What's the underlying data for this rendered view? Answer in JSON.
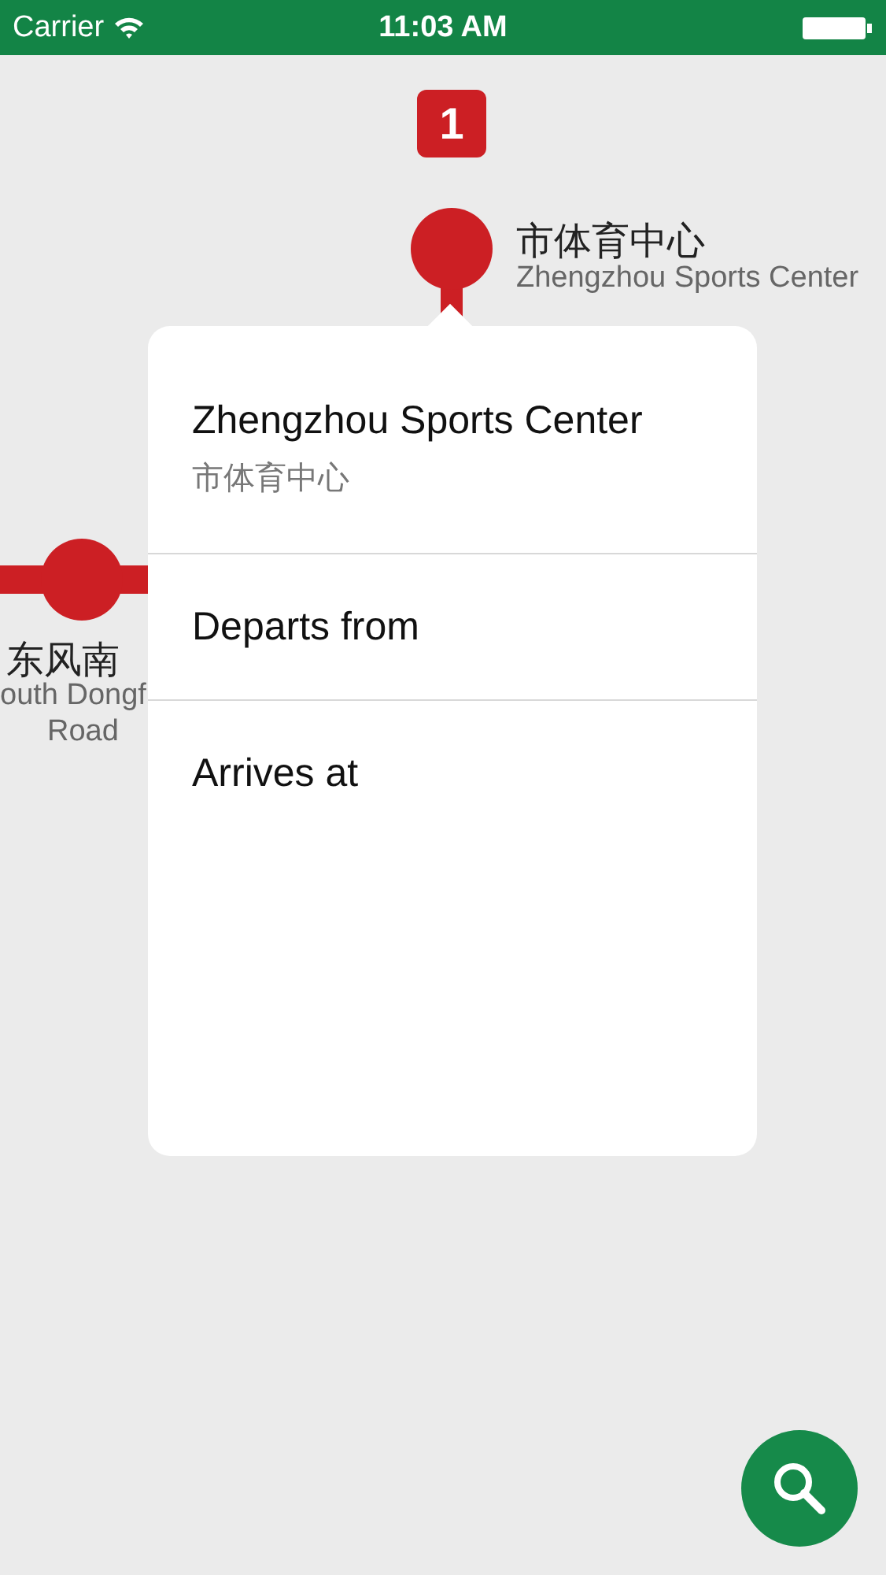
{
  "status_bar": {
    "carrier": "Carrier",
    "time": "11:03 AM"
  },
  "map": {
    "line_badge": "1",
    "stations": [
      {
        "kind": "top",
        "name_zh": "市体育中心",
        "name_en": "Zhengzhou Sports Center"
      },
      {
        "kind": "left",
        "name_zh": "东风南",
        "name_en": "outh Dongf",
        "name_en_2": "Road"
      }
    ]
  },
  "popover": {
    "title": "Zhengzhou Sports Center",
    "subtitle": "市体育中心",
    "rows": [
      {
        "label": "Departs from"
      },
      {
        "label": "Arrives at"
      }
    ]
  }
}
